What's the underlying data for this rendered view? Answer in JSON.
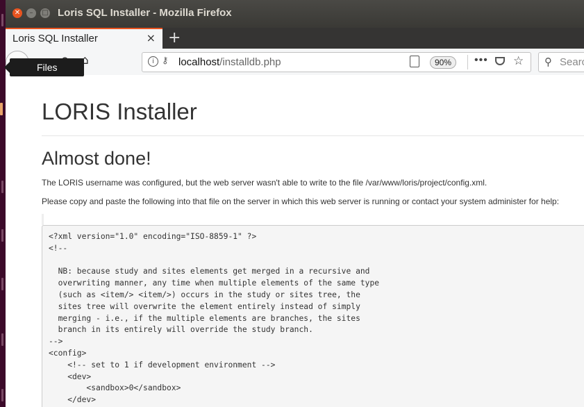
{
  "window": {
    "title": "Loris SQL Installer - Mozilla Firefox"
  },
  "tab": {
    "label": "Loris SQL Installer",
    "close": "×",
    "new_tab": "+"
  },
  "url": {
    "host": "localhost",
    "path": "/installdb.php",
    "zoom": "90%"
  },
  "search": {
    "placeholder": "Searc"
  },
  "tooltip": {
    "label": "Files"
  },
  "page": {
    "title": "LORIS Installer",
    "heading": "Almost done!",
    "para1": "The LORIS username was configured, but the web server wasn't able to write to the file /var/www/loris/project/config.xml.",
    "para2": "Please copy and paste the following into that file on the server in which this web server is running or contact your system administer for help:",
    "code": "<?xml version=\"1.0\" encoding=\"ISO-8859-1\" ?>\n<!--\n\n  NB: because study and sites elements get merged in a recursive and\n  overwriting manner, any time when multiple elements of the same type\n  (such as <item/> <item/>) occurs in the study or sites tree, the\n  sites tree will overwrite the element entirely instead of simply\n  merging - i.e., if the multiple elements are branches, the sites\n  branch in its entirely will override the study branch.\n-->\n<config>\n    <!-- set to 1 if development environment -->\n    <dev>\n        <sandbox>0</sandbox>\n    </dev>"
  },
  "colors": {
    "accent": "#e95420",
    "titlebar": "#3c3b37",
    "launcher": "#3c0a2a"
  },
  "icons": {
    "back": "back-arrow-icon",
    "reload": "reload-icon",
    "home": "home-icon",
    "info": "info-icon",
    "key": "key-icon",
    "reader": "reader-view-icon",
    "more": "more-actions-icon",
    "pocket": "pocket-icon",
    "star": "bookmark-star-icon",
    "search": "search-icon"
  }
}
